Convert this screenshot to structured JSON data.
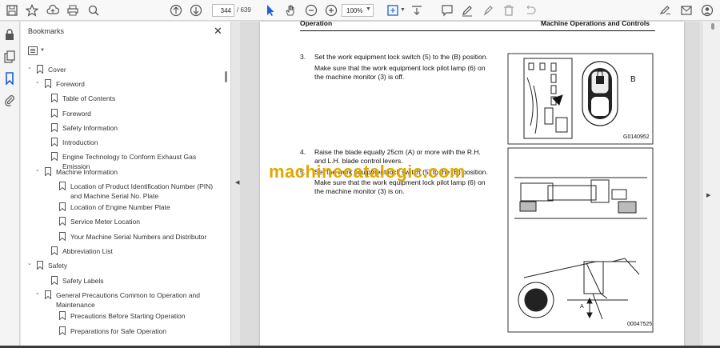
{
  "toolbar": {
    "page_current": "344",
    "page_total": "/ 639",
    "zoom": "100%"
  },
  "panel": {
    "title": "Bookmarks",
    "close": "✕"
  },
  "bookmarks": [
    {
      "label": "Cover",
      "level": 0,
      "caret": "⌄"
    },
    {
      "label": "Foreword",
      "level": 1,
      "caret": "⌄"
    },
    {
      "label": "Table of Contents",
      "level": 2,
      "caret": ""
    },
    {
      "label": "Foreword",
      "level": 2,
      "caret": ""
    },
    {
      "label": "Safety Information",
      "level": 2,
      "caret": ""
    },
    {
      "label": "Introduction",
      "level": 2,
      "caret": ""
    },
    {
      "label": "Engine Technology to Conform Exhaust Gas Emission",
      "level": 2,
      "caret": ""
    },
    {
      "label": "Machine Information",
      "level": 1,
      "caret": "⌄"
    },
    {
      "label": "Location of Product Identification Number (PIN) and Machine Serial No. Plate",
      "level": 3,
      "caret": ""
    },
    {
      "label": "Location of Engine Number Plate",
      "level": 3,
      "caret": ""
    },
    {
      "label": "Service Meter Location",
      "level": 3,
      "caret": ""
    },
    {
      "label": "Your Machine Serial Numbers and Distributor",
      "level": 3,
      "caret": ""
    },
    {
      "label": "Abbreviation List",
      "level": 2,
      "caret": ""
    },
    {
      "label": "Safety",
      "level": 0,
      "caret": "⌄"
    },
    {
      "label": "Safety Labels",
      "level": 2,
      "caret": ""
    },
    {
      "label": "General Precautions Common to Operation and Maintenance",
      "level": 1,
      "caret": "⌄"
    },
    {
      "label": "Precautions Before Starting Operation",
      "level": 3,
      "caret": ""
    },
    {
      "label": "Preparations for Safe Operation",
      "level": 3,
      "caret": ""
    }
  ],
  "document": {
    "header_left": "Operation",
    "header_right": "Machine Operations and Controls",
    "step3": {
      "num": "3.",
      "line1": "Set the work equipment lock switch (5) to the (B) position.",
      "line2": "Make sure that the work equipment lock pilot lamp (6) on",
      "line3": "the machine monitor (3) is off."
    },
    "step4": {
      "num": "4.",
      "line1": "Raise the blade equally 25cm (A) or more with the R.H.",
      "line2": "and L.H. blade control levers."
    },
    "step5": {
      "num": "5.",
      "line1": "Set the work equipment lock switch (5) to the (B) position.",
      "line2": "Make sure that the work equipment lock pilot lamp (6) on",
      "line3": "the machine monitor (3) is on."
    },
    "fig1_code": "G0140952",
    "fig1_label": "B",
    "fig2_code": "00047525",
    "fig2_label": "A",
    "watermark": "machinecatalogic.com"
  }
}
